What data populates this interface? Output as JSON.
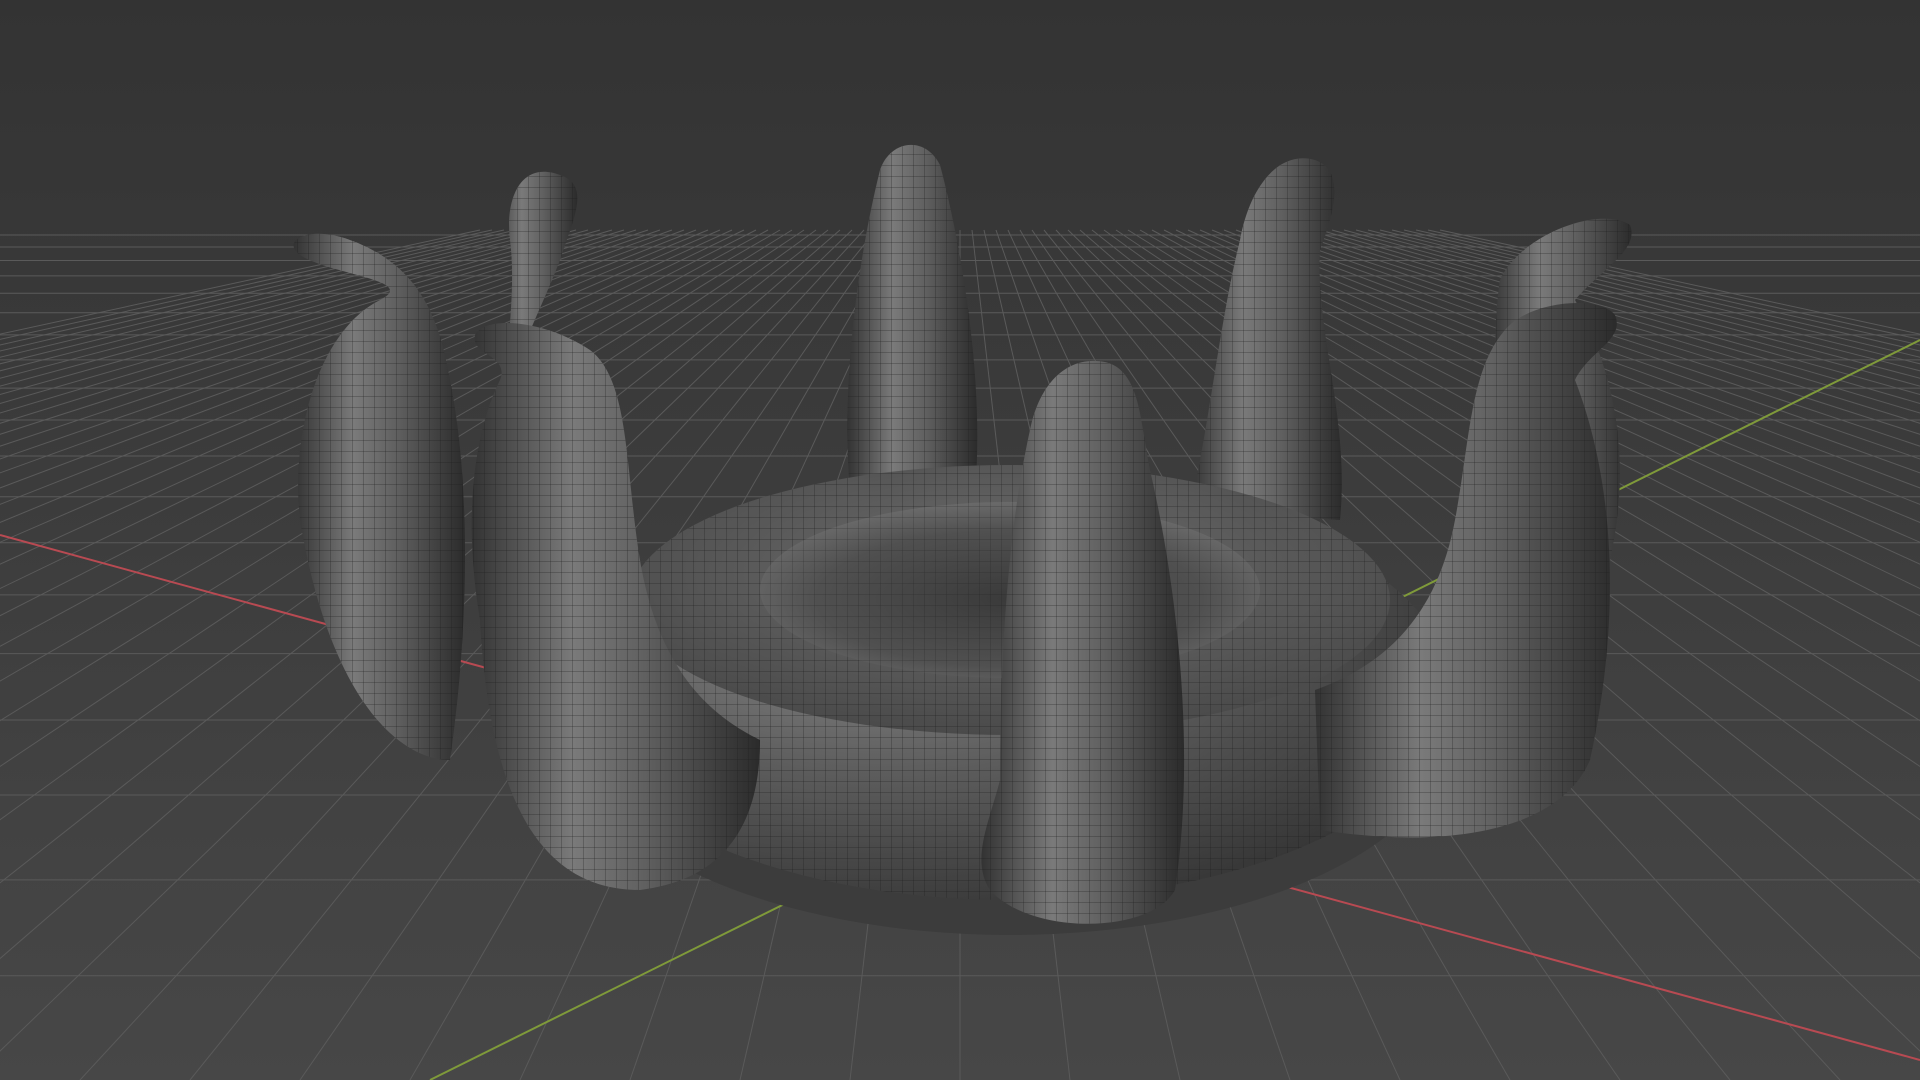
{
  "viewport": {
    "background_top": "#333333",
    "background_bottom": "#474747",
    "grid_color": "#5a5a5a",
    "axis_x_color": "#b84a52",
    "axis_y_color": "#7f9a3a"
  },
  "model": {
    "name": "inflatable-tentacle-ring",
    "surface_color": "#5b5b5b",
    "wire_color": "#1c1c1c",
    "tentacle_count": 8,
    "display_mode": "solid-with-wireframe"
  }
}
